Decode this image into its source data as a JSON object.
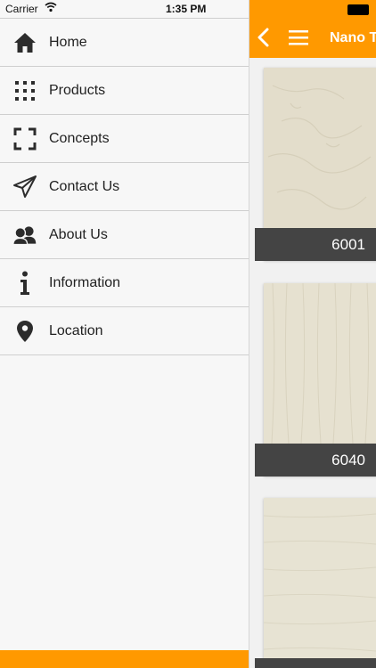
{
  "status_bar": {
    "carrier": "Carrier",
    "time": "1:35 PM"
  },
  "menu": {
    "items": [
      {
        "label": "Home",
        "icon": "home-icon"
      },
      {
        "label": "Products",
        "icon": "grid-icon"
      },
      {
        "label": "Concepts",
        "icon": "focus-frame-icon"
      },
      {
        "label": "Contact Us",
        "icon": "paper-plane-icon"
      },
      {
        "label": "About Us",
        "icon": "people-icon"
      },
      {
        "label": "Information",
        "icon": "info-icon"
      },
      {
        "label": "Location",
        "icon": "location-pin-icon"
      }
    ]
  },
  "header": {
    "title": "Nano T"
  },
  "products": [
    {
      "code": "6001",
      "color": "#e3ddcb"
    },
    {
      "code": "6040",
      "color": "#e6e1d0"
    },
    {
      "code": "",
      "color": "#e7e3d3"
    }
  ],
  "colors": {
    "accent": "#ff9900",
    "caption_bg": "#444444"
  }
}
